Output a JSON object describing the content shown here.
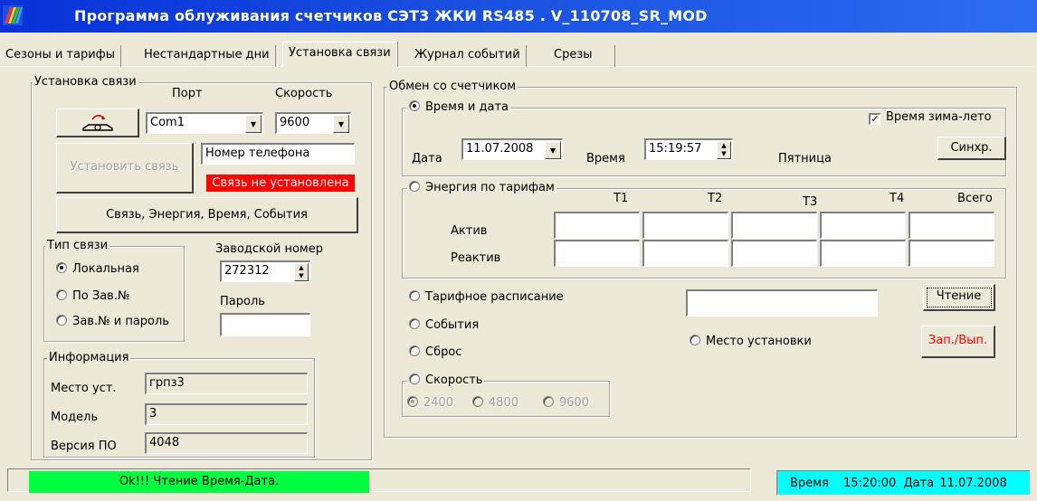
{
  "window": {
    "title": "Программа облуживания счетчиков СЭТ3   ЖКИ RS485 .  V_110708_SR_MOD",
    "icon": "app-rainbow-icon"
  },
  "tabs": [
    {
      "label": "Сезоны и тарифы"
    },
    {
      "label": "Нестандартные дни"
    },
    {
      "label": "Установка связи"
    },
    {
      "label": "Журнал событий"
    },
    {
      "label": "Срезы"
    }
  ],
  "connection": {
    "group_label": "Установка связи",
    "port_label": "Порт",
    "speed_label": "Скорость",
    "port_value": "Com1",
    "speed_value": "9600",
    "phone_placeholder": "Номер телефона",
    "connect_button": "Установить связь",
    "status_text": "Связь не установлена",
    "status_color": "#ff0000",
    "full_button": "Связь, Энергия, Время, События",
    "link_type": {
      "group_label": "Тип связи",
      "options": [
        "Локальная",
        "По Зав.№",
        "Зав.№ и пароль"
      ],
      "selected": "Локальная"
    },
    "serial_label": "Заводской номер",
    "serial_value": "272312",
    "password_label": "Пароль",
    "password_value": ""
  },
  "info": {
    "group_label": "Информация",
    "location_label": "Место уст.",
    "location_value": "грпз3",
    "model_label": "Модель",
    "model_value": "3",
    "version_label": "Версия ПО",
    "version_value": "4048"
  },
  "exchange": {
    "group_label": "Обмен со счетчиком",
    "datetime": {
      "radio_label": "Время и дата",
      "dst_label": "Время зима-лето",
      "dst_checked": true,
      "date_label": "Дата",
      "date_value": "11.07.2008",
      "time_label": "Время",
      "time_value": "15:19:57",
      "weekday": "Пятница",
      "sync_button": "Синхр."
    },
    "energy": {
      "radio_label": "Энергия по тарифам",
      "columns": [
        "T1",
        "T2",
        "T3",
        "T4",
        "Всего"
      ],
      "rows": [
        "Актив",
        "Реактив"
      ]
    },
    "options": {
      "schedule": "Тарифное расписание",
      "events": "События",
      "reset": "Сброс",
      "location": "Место установки"
    },
    "speed": {
      "group_label": "Скорость",
      "options": [
        "2400",
        "4800",
        "9600"
      ],
      "selected": "2400"
    },
    "read_button": "Чтение",
    "write_button": "Зап./Вып.",
    "write_color": "#ff0000"
  },
  "statusbar": {
    "message": "Ok!!! Чтение Время-Дата.",
    "message_bg": "#00ff40",
    "time_label": "Время",
    "time_value": "15:20:00",
    "date_label": "Дата",
    "date_value": "11.07.2008",
    "clock_bg": "#00ffff"
  }
}
